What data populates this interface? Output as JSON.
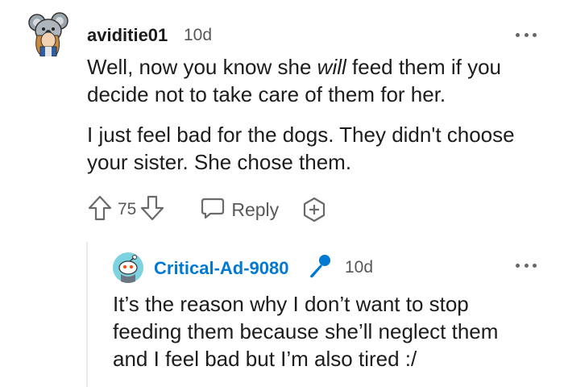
{
  "comment": {
    "username": "aviditie01",
    "time": "10d",
    "paragraph1": {
      "before": "Well, now you know she ",
      "emphasis": "will",
      "after_line1": " feed them if you",
      "line2": "decide not to take care of them for her."
    },
    "paragraph2": {
      "line1": "I just feel bad for the dogs. They didn't choose",
      "line2": "your sister. She chose them."
    },
    "votes": "75",
    "reply_label": "Reply",
    "avatar_icon": "koala-avatar-icon"
  },
  "reply": {
    "username": "Critical-Ad-9080",
    "time": "10d",
    "text_line1": "It’s the reason why I don’t want to stop",
    "text_line2": "feeding them because she’ll neglect them",
    "text_line3": "and I feel bad but I’m also tired :/",
    "username_color": "#0079d3",
    "mic_color": "#0079d3"
  }
}
